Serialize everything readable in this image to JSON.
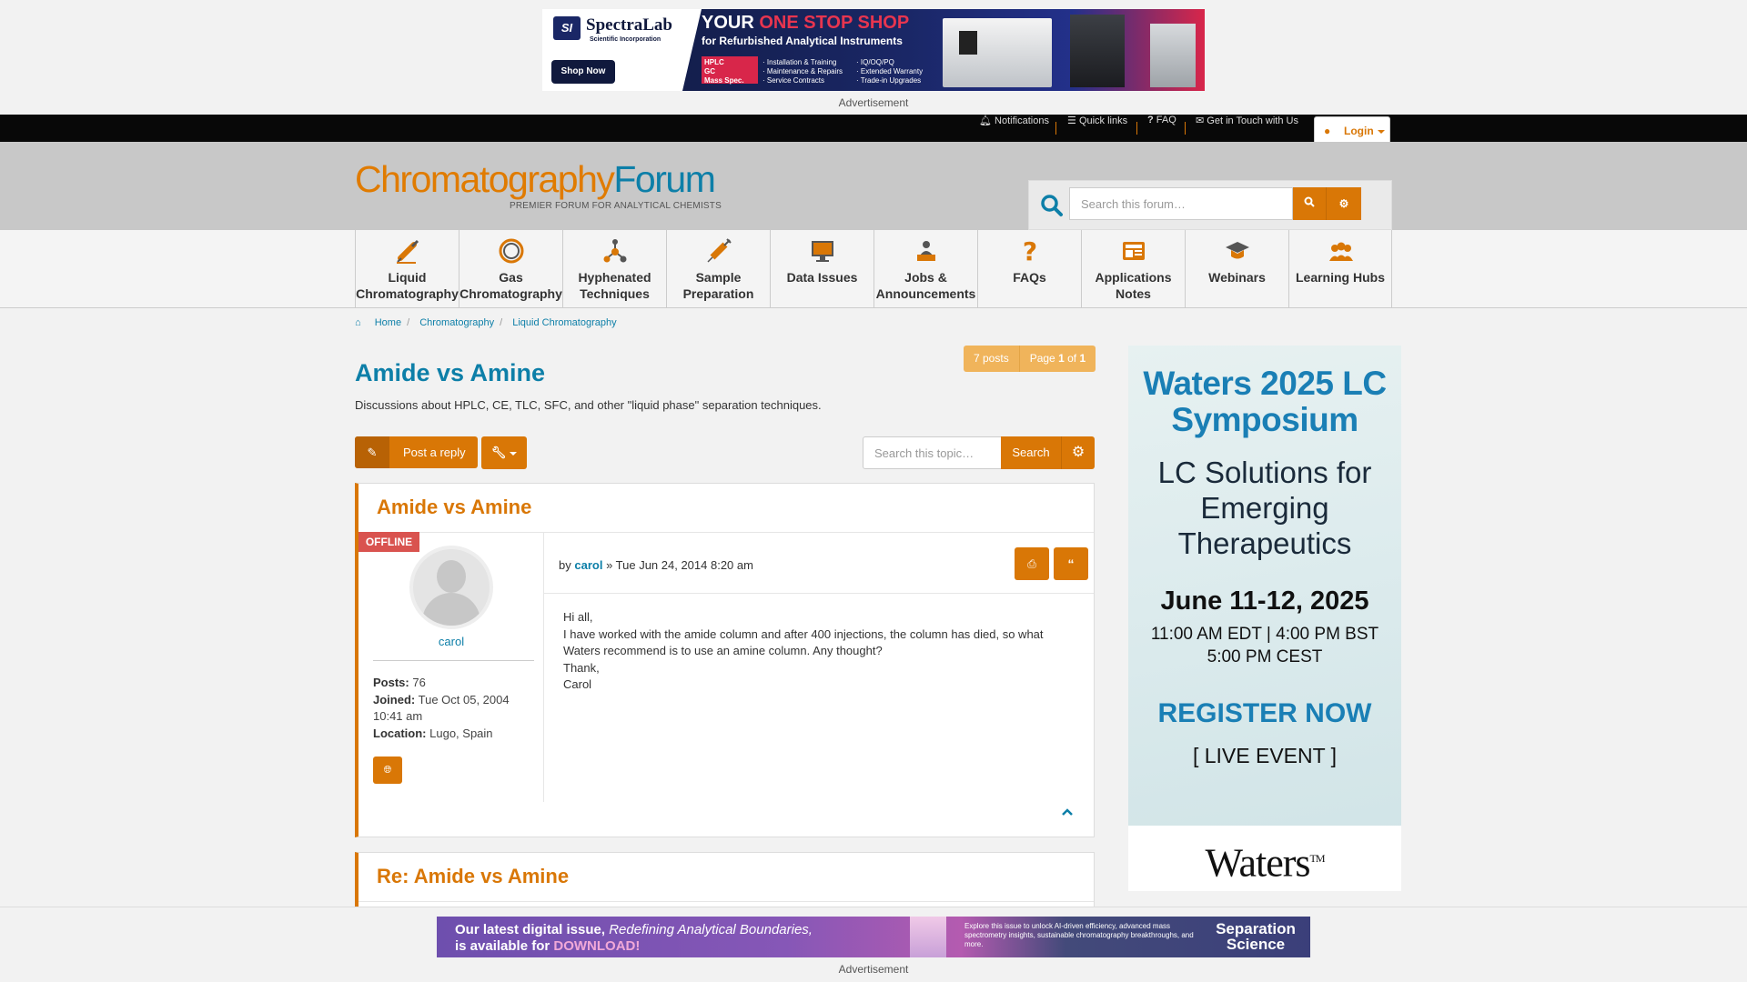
{
  "top_ad": {
    "brand": "SpectraLab",
    "brand_sub": "Scientific Incorporation",
    "headline_a": "YOUR ",
    "headline_b": "ONE STOP SHOP",
    "subline": "for Refurbished Analytical Instruments",
    "tags": [
      "HPLC",
      "GC",
      "Mass Spec."
    ],
    "list_a": [
      "Installation & Training",
      "Maintenance & Repairs",
      "Service Contracts"
    ],
    "list_b": [
      "IQ/OQ/PQ",
      "Extended Warranty",
      "Trade-in Upgrades"
    ],
    "cta": "Shop Now",
    "label": "Advertisement"
  },
  "topbar": {
    "notifications": "Notifications",
    "quick_links": "Quick links",
    "faq": "FAQ",
    "contact": "Get in Touch with Us",
    "login": "Login"
  },
  "header": {
    "logo_main": "Chromatography",
    "logo_second": "Forum",
    "tagline": "PREMIER FORUM FOR ANALYTICAL CHEMISTS",
    "search_placeholder": "Search this forum…"
  },
  "nav": [
    {
      "label": "Liquid Chromatography",
      "icon": "pipette-icon"
    },
    {
      "label": "Gas Chromatography",
      "icon": "gc-column-icon"
    },
    {
      "label": "Hyphenated Techniques",
      "icon": "molecule-icon"
    },
    {
      "label": "Sample Preparation",
      "icon": "syringe-icon"
    },
    {
      "label": "Data Issues",
      "icon": "monitor-icon"
    },
    {
      "label": "Jobs & Announcements",
      "icon": "people-icon"
    },
    {
      "label": "FAQs",
      "icon": "question-icon"
    },
    {
      "label": "Applications Notes",
      "icon": "news-icon"
    },
    {
      "label": "Webinars",
      "icon": "graduation-icon"
    },
    {
      "label": "Learning Hubs",
      "icon": "group-icon"
    }
  ],
  "breadcrumb": [
    "Home",
    "Chromatography",
    "Liquid Chromatography"
  ],
  "topic": {
    "title": "Amide vs Amine",
    "description": "Discussions about HPLC, CE, TLC, SFC, and other \"liquid phase\" separation techniques.",
    "posts_count": "7 posts",
    "page_label": "Page",
    "page_current": "1",
    "page_of": "of",
    "page_total": "1",
    "reply_label": "Post a reply",
    "search_placeholder": "Search this topic…",
    "search_label": "Search"
  },
  "posts": [
    {
      "title": "Amide vs Amine",
      "status": "OFFLINE",
      "author": "carol",
      "by": "by",
      "date": "» Tue Jun 24, 2014 8:20 am",
      "stats": [
        {
          "label": "Posts:",
          "value": "76"
        },
        {
          "label": "Joined:",
          "value": "Tue Oct 05, 2004 10:41 am"
        },
        {
          "label": "Location:",
          "value": "Lugo, Spain"
        }
      ],
      "body": [
        "Hi all,",
        "I have worked with the amide column and after 400 injections, the column has died, so what Waters recommend is to use an amine column. Any thought?",
        "Thank,",
        "Carol"
      ]
    },
    {
      "title": "Re: Amide vs Amine"
    }
  ],
  "side_ad": {
    "title": "Waters 2025 LC Symposium",
    "subtitle": "LC Solutions for Emerging Therapeutics",
    "dates": "June 11-12, 2025",
    "times_a": "11:00 AM EDT |  4:00 PM BST",
    "times_b": "5:00 PM CEST",
    "cta": "REGISTER NOW",
    "event": "[ LIVE EVENT ]",
    "brand": "Waters"
  },
  "bottom_ad": {
    "line1_a": "Our latest digital issue, ",
    "line1_b": "Redefining Analytical Boundaries,",
    "line2_a": "is available for ",
    "line2_b": "DOWNLOAD!",
    "middle": "Explore this issue to unlock AI-driven efficiency, advanced mass spectrometry insights, sustainable chromatography breakthroughs, and more.",
    "brand": "Separation Science",
    "label": "Advertisement"
  },
  "colors": {
    "accent": "#d97706",
    "link": "#0d7fa8",
    "offline": "#d9534f",
    "header_bg": "#c8c8c8",
    "topbar_bg": "#080808"
  }
}
